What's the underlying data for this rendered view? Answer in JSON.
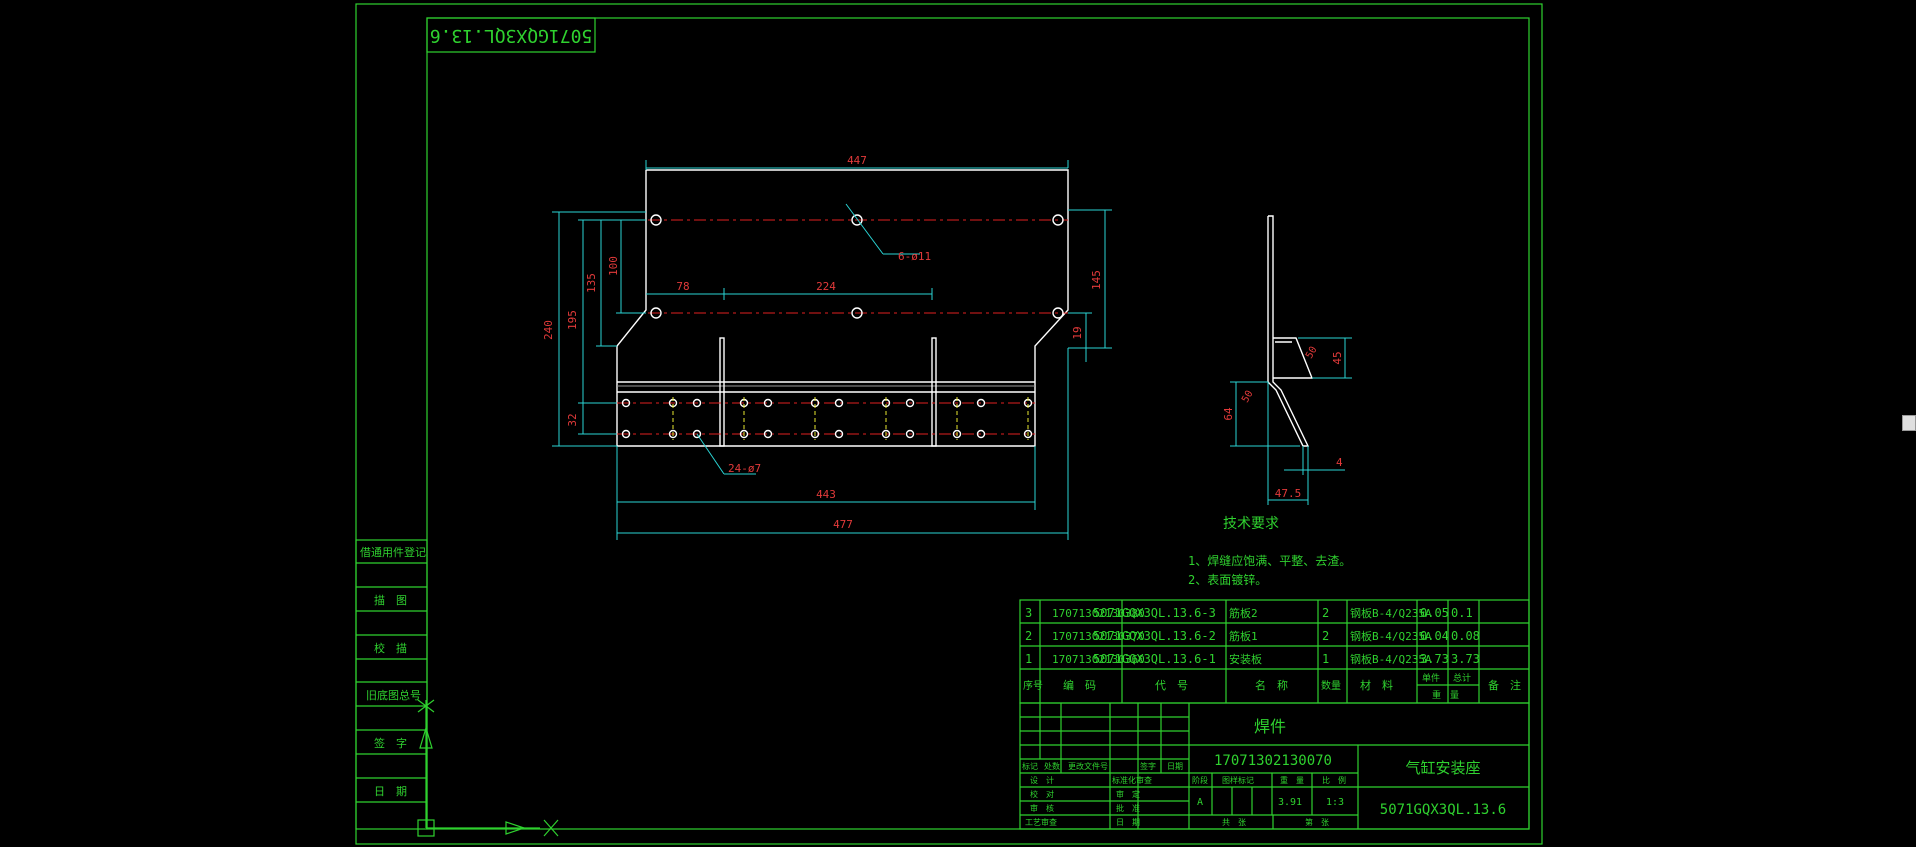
{
  "drawing_number_top": "5071GQX3QL.13.6",
  "front_view": {
    "dimensions": {
      "width_top": "447",
      "hole_note_top": "6-ø11",
      "offset_78": "78",
      "spacing_224": "224",
      "height_240": "240",
      "height_195": "195",
      "height_135": "135",
      "height_100": "100",
      "right_145": "145",
      "right_19": "19",
      "bottom_32": "32",
      "hole_note_bottom": "24-ø7",
      "width_443": "443",
      "width_477": "477"
    }
  },
  "side_view": {
    "dimensions": {
      "angle_top": "50",
      "angle_bottom": "50",
      "height_45": "45",
      "height_64": "64",
      "thickness_4": "4",
      "width_47_5": "47.5"
    }
  },
  "tech_requirements": {
    "title": "技术要求",
    "items": [
      "1、焊缝应饱满、平整、去渣。",
      "2、表面镀锌。"
    ]
  },
  "side_labels": [
    "借通用件登记",
    "描　图",
    "校　描",
    "旧底图总号",
    "签　字",
    "日　期"
  ],
  "bom": {
    "rows": [
      {
        "no": "3",
        "code": "17071302130380",
        "drawing": "5071GQX3QL.13.6-3",
        "name": "筋板2",
        "qty": "2",
        "material": "钢板B-4/Q235A",
        "unit": "0.05",
        "total": "0.1"
      },
      {
        "no": "2",
        "code": "17071302130370",
        "drawing": "5071GQX3QL.13.6-2",
        "name": "筋板1",
        "qty": "2",
        "material": "钢板B-4/Q235A",
        "unit": "0.04",
        "total": "0.08"
      },
      {
        "no": "1",
        "code": "17071302130360",
        "drawing": "5071GQX3QL.13.6-1",
        "name": "安装板",
        "qty": "1",
        "material": "钢板B-4/Q235A",
        "unit": "3.73",
        "total": "3.73"
      }
    ],
    "header": {
      "no": "序号",
      "code": "编　码",
      "drawing": "代　号",
      "name": "名　称",
      "qty": "数量",
      "material": "材　料",
      "unit": "单件",
      "total": "总计",
      "weight": "重　量",
      "remark": "备　注"
    }
  },
  "title_block": {
    "type": "焊件",
    "code": "17071302130070",
    "part_name": "气缸安装座",
    "drawing_number": "5071GQX3QL.13.6",
    "mark": "A",
    "weight": "3.91",
    "scale": "1:3",
    "col_labels": [
      "标记",
      "处数",
      "更改文件号",
      "签字",
      "日期"
    ],
    "left_labels": [
      "设　计",
      "校　对",
      "审　核",
      "工艺审查"
    ],
    "mid_labels": [
      "标准化审查",
      "审　定",
      "批　准",
      "日　期"
    ],
    "right_headers": [
      "图样标记",
      "重　量",
      "比　例"
    ],
    "bottom_labels": [
      "共　张",
      "第　张"
    ],
    "stage": "阶段"
  }
}
